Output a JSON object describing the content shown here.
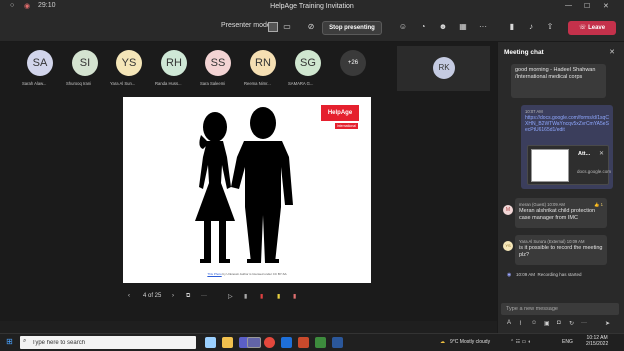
{
  "window": {
    "title": "HelpAge Training Invitation"
  },
  "toolbar": {
    "timer": "29:10",
    "presenter_mode_label": "Presenter mode",
    "stop_presenting_label": "Stop presenting",
    "leave_label": "Leave"
  },
  "participants": [
    {
      "initials": "SA",
      "name": "Sarah Alaw...",
      "color": "#d2d5eb"
    },
    {
      "initials": "SI",
      "name": "Shurooq Irani",
      "color": "#d4e3d0"
    },
    {
      "initials": "YS",
      "name": "Yara Al Sun...",
      "color": "#f5e6b8"
    },
    {
      "initials": "RH",
      "name": "Randa Huss...",
      "color": "#cfe8d6"
    },
    {
      "initials": "SS",
      "name": "Sara Saleemi",
      "color": "#f3d3d3"
    },
    {
      "initials": "RN",
      "name": "Reema Nimr...",
      "color": "#f5dfb3"
    },
    {
      "initials": "SG",
      "name": "SAMARA G...",
      "color": "#cfe6cf"
    }
  ],
  "more_participants": "+26",
  "rk_tile": {
    "initials": "RK"
  },
  "slide": {
    "logo_main": "HelpAge",
    "logo_sub": "International",
    "caption_link": "This Photo",
    "caption_rest": " by Unknown Author is licensed under CC BY-SA"
  },
  "slide_nav": {
    "position": "4 of 25"
  },
  "chat": {
    "title": "Meeting chat",
    "msg1_text": "good morning - Hadeel Shahwan /International medical corps",
    "msg2_time": "10:07 AM",
    "msg2_link": "https://docs.google.com/forms/d/1sqCXHN_B2WTWaYncqv5xZvrCmYA5eSecPtU6165d1/edit",
    "card_title": "Att...",
    "card_domain": "docs.google.com",
    "msg3_avatar": "M",
    "msg3_sender": "meran (Guest)",
    "msg3_time": "10:09 AM",
    "msg3_reaction": "👍 1",
    "msg3_text": "Meran alshrikat child protection case manager from IMC",
    "msg4_avatar": "YS",
    "msg4_sender": "Yara Al Suna'a (External)",
    "msg4_time": "10:09 AM",
    "msg4_text": "is it possible to record the meeting plz?",
    "sys_time": "10:09 AM",
    "sys_text": "Recording has started",
    "composer_placeholder": "Type a new message"
  },
  "taskbar": {
    "search_placeholder": "Type here to search",
    "weather": "9°C  Mostly cloudy",
    "lang": "ENG",
    "time": "10:12 AM",
    "date": "2/15/2022"
  }
}
